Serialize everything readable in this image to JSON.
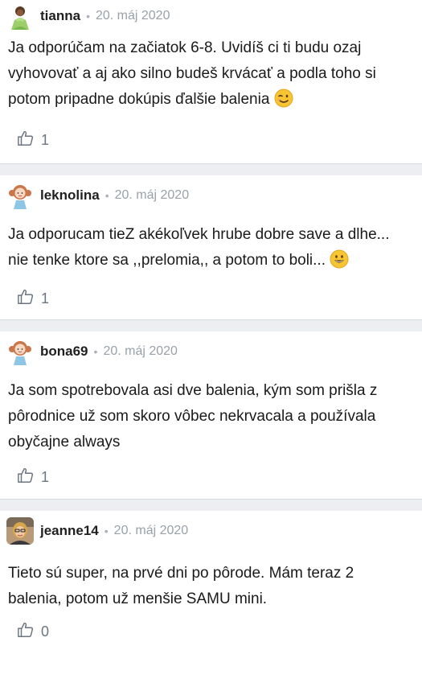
{
  "comments": [
    {
      "username": "tianna",
      "avatar_icon": "princess-tiana-avatar",
      "date": "20. máj 2020",
      "text": "Ja odporúčam na začiatok 6-8. Uvidíš ci ti budu ozaj vyhovovať a aj ako silno budeš krvácať a podla toho si potom pripadne dokúpis ďalšie balenia",
      "emoji": "winking-face-emoji",
      "likes": "1"
    },
    {
      "username": "leknolina",
      "avatar_icon": "girl-cartoon-avatar",
      "date": "20. máj 2020",
      "text": "Ja odporucam tieZ akékoľvek hrube dobre save a dlhe... nie tenke ktore sa ,,prelomia,, a potom to boli...",
      "emoji": "grinning-face-emoji",
      "likes": "1"
    },
    {
      "username": "bona69",
      "avatar_icon": "girl-cartoon-avatar",
      "date": "20. máj 2020",
      "text": "Ja som spotrebovala asi dve balenia, kým som prišla z pôrodnice už som skoro vôbec nekrvacala a používala obyčajne always",
      "emoji": "",
      "likes": "1"
    },
    {
      "username": "jeanne14",
      "avatar_icon": "photo-woman-avatar",
      "date": "20. máj 2020",
      "text": "Tieto sú super, na prvé dni po pôrode. Mám teraz 2 balenia, potom už menšie SAMU mini.",
      "emoji": "",
      "likes": "0"
    }
  ]
}
